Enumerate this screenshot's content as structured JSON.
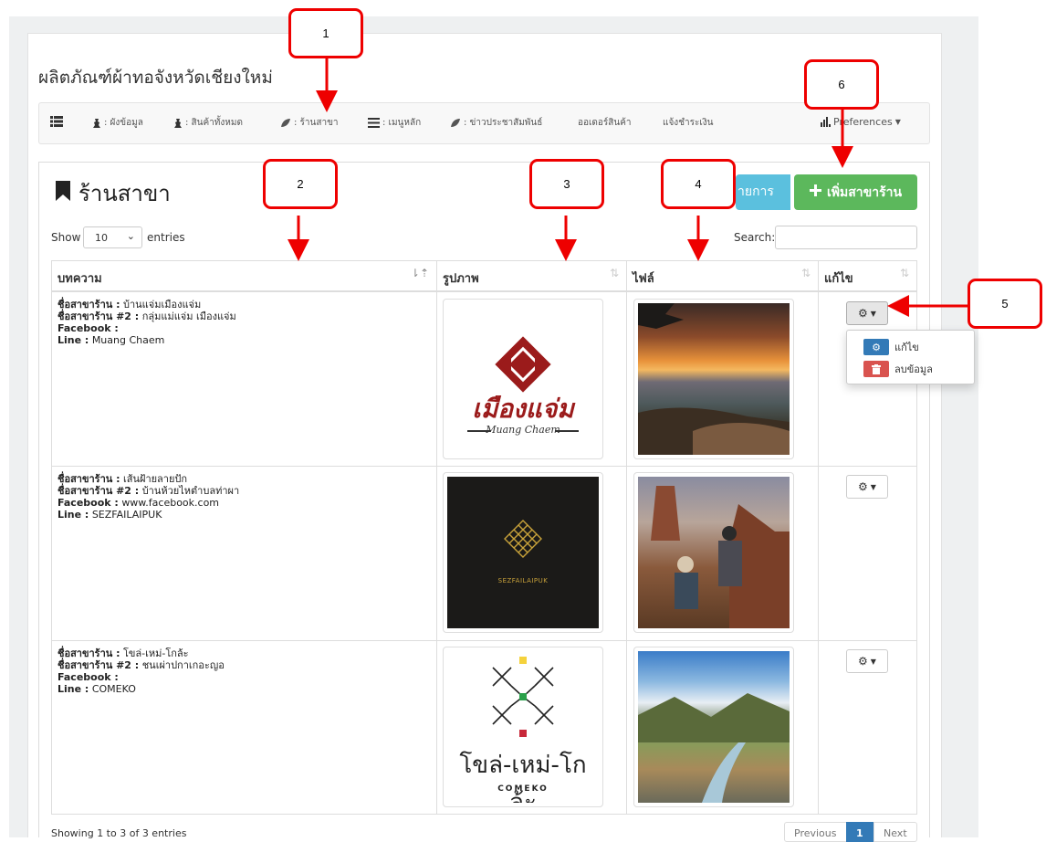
{
  "page_title": "ผลิตภัณฑ์ผ้าทอจังหวัดเชียงใหม่",
  "navbar": {
    "items": [
      {
        "icon": "list-icon",
        "label": ""
      },
      {
        "icon": "chess-icon",
        "label": ": ผังข้อมูล"
      },
      {
        "icon": "chess-icon",
        "label": ": สินค้าทั้งหมด"
      },
      {
        "icon": "leaf-icon",
        "label": ": ร้านสาขา"
      },
      {
        "icon": "list-icon",
        "label": ": เมนูหลัก"
      },
      {
        "icon": "leaf-icon",
        "label": ": ข่าวประชาสัมพันธ์"
      },
      {
        "icon": "",
        "label": "ออเดอร์สินค้า"
      },
      {
        "icon": "",
        "label": "แจ้งชำระเงิน"
      }
    ],
    "preferences_label": "Preferences"
  },
  "section": {
    "title": "ร้านสาขา",
    "list_button_label": "ายการ",
    "add_button_label": "เพิ่มสาขาร้าน"
  },
  "table_controls": {
    "show_label": "Show",
    "length_value": "10",
    "entries_label": "entries",
    "search_label": "Search:",
    "search_value": ""
  },
  "table": {
    "columns": [
      "บทความ",
      "รูปภาพ",
      "ไฟล์",
      "แก้ไข"
    ],
    "rows": [
      {
        "name_label": "ชื่อสาขาร้าน :",
        "name": "บ้านแจ่มเมืองแจ่ม",
        "name2_label": "ชื่อสาขาร้าน #2 :",
        "name2": "กลุ่มแม่แจ่ม เมืองแจ่ม",
        "facebook_label": "Facebook :",
        "facebook": "",
        "line_label": "Line :",
        "line": "Muang Chaem",
        "logo_text": "เมืองแจ่ม",
        "logo_subtext": "Muang Chaem"
      },
      {
        "name_label": "ชื่อสาขาร้าน :",
        "name": "เส้นฝ้ายลายปัก",
        "name2_label": "ชื่อสาขาร้าน #2 :",
        "name2": "บ้านห้วยไหตำบลท่าผา",
        "facebook_label": "Facebook :",
        "facebook": "www.facebook.com",
        "line_label": "Line :",
        "line": "SEZFAILAIPUK",
        "logo_text": "SEZFAILAIPUK",
        "logo_subtext": ""
      },
      {
        "name_label": "ชื่อสาขาร้าน :",
        "name": "โขล่-เหม่-โกล้ะ",
        "name2_label": "ชื่อสาขาร้าน #2 :",
        "name2": "ชนเผ่าปกาเกอะญอ",
        "facebook_label": "Facebook :",
        "facebook": "",
        "line_label": "Line :",
        "line": "COMEKO",
        "logo_text": "โขล่-เหม่-โกล้ะ",
        "logo_subtext": "COMEKO"
      }
    ]
  },
  "dropdown": {
    "edit_label": "แก้ไข",
    "delete_label": "ลบข้อมูล"
  },
  "footer": {
    "info": "Showing 1 to 3 of 3 entries",
    "prev_label": "Previous",
    "page_label": "1",
    "next_label": "Next"
  },
  "callouts": [
    "1",
    "2",
    "3",
    "4",
    "5",
    "6"
  ],
  "colors": {
    "accent_red": "#ee0000",
    "btn_info": "#5bc0de",
    "btn_success": "#5cb85c",
    "btn_primary": "#337ab7",
    "btn_danger": "#d9534f"
  }
}
